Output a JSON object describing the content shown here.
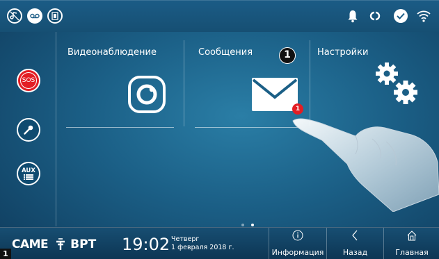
{
  "tiles": [
    {
      "label": "Видеонаблюдение",
      "icon": "camera-icon"
    },
    {
      "label": "Сообщения",
      "icon": "envelope-icon",
      "badge": "1",
      "callout": "1"
    },
    {
      "label": "Настройки",
      "icon": "gears-icon"
    }
  ],
  "sidebar": {
    "sos_label": "SOS",
    "aux_label": "AUX"
  },
  "footer": {
    "brand_came": "CAME",
    "brand_bpt": "BPT",
    "time": "19:02",
    "weekday": "Четверг",
    "date": "1 февраля 2018 г.",
    "figure_number": "1"
  },
  "nav": {
    "info": "Информация",
    "back": "Назад",
    "home": "Главная"
  },
  "colors": {
    "accent_red": "#e31e24",
    "background": "#1b5f86"
  }
}
